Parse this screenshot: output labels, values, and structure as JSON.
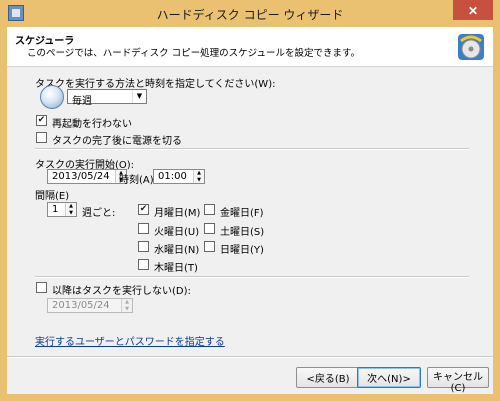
{
  "window": {
    "title": "ハードディスク コピー ウィザード",
    "close": "✕"
  },
  "header": {
    "title": "スケジューラ",
    "subtitle": "このページでは、ハードディスク コピー処理のスケジュールを設定できます。"
  },
  "method": {
    "label": "タスクを実行する方法と時刻を指定してください(W):",
    "selected": "毎週"
  },
  "options": {
    "no_reboot": {
      "label": "再起動を行わない",
      "checked": true
    },
    "power_off": {
      "label": "タスクの完了後に電源を切る",
      "checked": false
    }
  },
  "start": {
    "label": "タスクの実行開始(O):",
    "date": "2013/05/24",
    "time_label": "時刻(A)",
    "time": "01:00"
  },
  "interval": {
    "label": "間隔(E)",
    "value": "1",
    "unit": "週ごと:"
  },
  "days": [
    {
      "label": "月曜日(M)",
      "checked": true
    },
    {
      "label": "火曜日(U)",
      "checked": false
    },
    {
      "label": "水曜日(N)",
      "checked": false
    },
    {
      "label": "木曜日(T)",
      "checked": false
    },
    {
      "label": "金曜日(F)",
      "checked": false
    },
    {
      "label": "土曜日(S)",
      "checked": false
    },
    {
      "label": "日曜日(Y)",
      "checked": false
    }
  ],
  "end": {
    "label": "以降はタスクを実行しない(D):",
    "checked": false,
    "date": "2013/05/24"
  },
  "credentials_link": "実行するユーザーとパスワードを指定する",
  "buttons": {
    "back": "<戻る(B)",
    "next": "次へ(N)>",
    "cancel": "キャンセル(C)"
  },
  "check_mark": "✔",
  "spin_up": "▲",
  "spin_down": "▼",
  "combo_arrow": "▼"
}
